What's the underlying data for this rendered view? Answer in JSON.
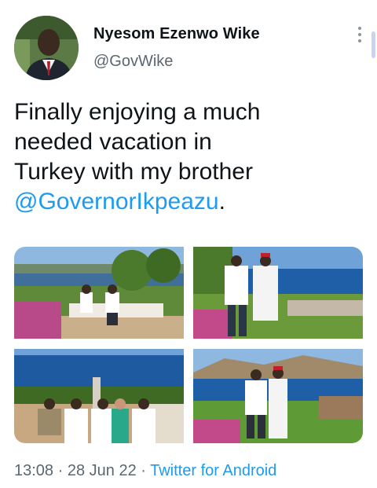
{
  "user": {
    "display_name": "Nyesom Ezenwo Wike",
    "handle": "@GovWike"
  },
  "tweet": {
    "lines": [
      "Finally enjoying a much",
      "needed vacation in",
      "Turkey with my brother"
    ],
    "mention": "@GovernorIkpeazu",
    "trailing": "."
  },
  "meta": {
    "time": "13:08",
    "separator": " · ",
    "date": "28 Jun 22",
    "source": "Twitter for Android"
  },
  "colors": {
    "accent": "#1d9bf0",
    "secondary_text": "#5b6770"
  },
  "icons": {
    "more": "more-vertical-icon"
  }
}
